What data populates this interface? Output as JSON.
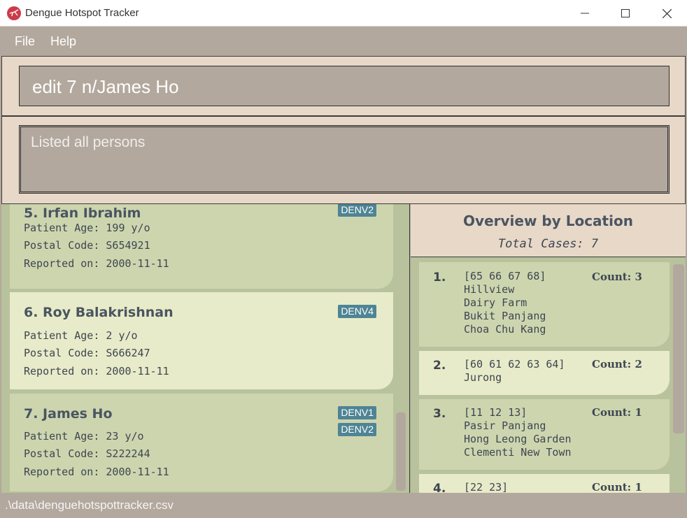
{
  "window": {
    "title": "Dengue Hotspot Tracker"
  },
  "menu": {
    "file": "File",
    "help": "Help"
  },
  "command": {
    "value": "edit 7 n/James Ho"
  },
  "result": {
    "text": "Listed all persons"
  },
  "persons": [
    {
      "name": "5. Irfan Ibrahim",
      "age": "Patient Age: 199 y/o",
      "postal": "Postal Code: S654921",
      "reported": "Reported on: 2000-11-11",
      "tags": [
        "DENV2"
      ]
    },
    {
      "name": "6. Roy Balakrishnan",
      "age": "Patient Age: 2 y/o",
      "postal": "Postal Code: S666247",
      "reported": "Reported on: 2000-11-11",
      "tags": [
        "DENV4"
      ]
    },
    {
      "name": "7. James Ho",
      "age": "Patient Age: 23 y/o",
      "postal": "Postal Code: S222244",
      "reported": "Reported on: 2000-11-11",
      "tags": [
        "DENV1",
        "DENV2"
      ]
    }
  ],
  "overview": {
    "title": "Overview by Location",
    "total": "Total Cases: 7",
    "locations": [
      {
        "num": "1.",
        "lines": [
          "[65 66 67 68]",
          "Hillview",
          "Dairy Farm",
          "Bukit Panjang",
          "Choa Chu Kang"
        ],
        "count": "Count: 3"
      },
      {
        "num": "2.",
        "lines": [
          "[60 61 62 63 64]",
          "Jurong"
        ],
        "count": "Count: 2"
      },
      {
        "num": "3.",
        "lines": [
          "[11 12 13]",
          "Pasir Panjang",
          "Hong Leong Garden",
          "Clementi New Town"
        ],
        "count": "Count: 1"
      },
      {
        "num": "4.",
        "lines": [
          "[22 23]"
        ],
        "count": "Count: 1"
      }
    ]
  },
  "status": {
    "path": ".\\data\\denguehotspottracker.csv"
  },
  "colors": {
    "accent": "#4e8494",
    "card_a": "#cdd5af",
    "card_b": "#e8ebc9",
    "panel": "#b3a89d",
    "header": "#e8d8c8",
    "app_icon": "#cc3b4b"
  }
}
